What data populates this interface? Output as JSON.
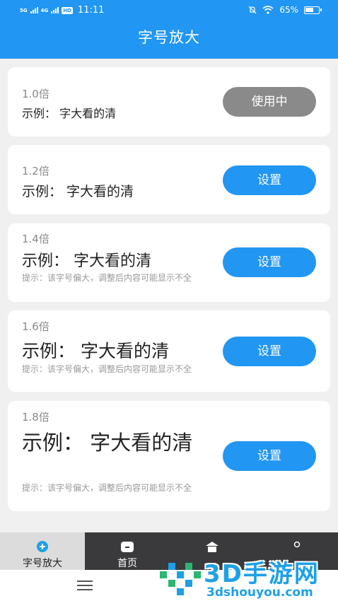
{
  "status_bar": {
    "network_1": "5G",
    "network_2": "4G",
    "hd_badge": "HD",
    "time": "11:11",
    "battery_percent": "65%",
    "battery_level": 0.65,
    "icons": [
      "mute-icon",
      "wifi-icon",
      "battery-icon"
    ]
  },
  "header": {
    "title": "字号放大"
  },
  "options": [
    {
      "level": "1.0倍",
      "example": "示例：  字大看的清",
      "hint": "",
      "button": "使用中",
      "state": "active"
    },
    {
      "level": "1.2倍",
      "example": "示例：  字大看的清",
      "hint": "",
      "button": "设置",
      "state": "set"
    },
    {
      "level": "1.4倍",
      "example": "示例：  字大看的清",
      "hint": "提示：该字号偏大，调整后内容可能显示不全",
      "button": "设置",
      "state": "set"
    },
    {
      "level": "1.6倍",
      "example": "示例：  字大看的清",
      "hint": "提示：该字号偏大，调整后内容可能显示不全",
      "button": "设置",
      "state": "set"
    },
    {
      "level": "1.8倍",
      "example": "示例：  字大看的清",
      "hint": "提示：该字号偏大，调整后内容可能显示不全",
      "button": "设置",
      "state": "set"
    }
  ],
  "tabs": [
    {
      "label": "字号放大",
      "icon": "font-size-icon",
      "selected": true
    },
    {
      "label": "首页",
      "icon": "home-icon",
      "selected": false
    },
    {
      "label": "",
      "icon": "tab-icon",
      "selected": false
    },
    {
      "label": "",
      "icon": "profile-icon",
      "selected": false
    }
  ],
  "watermark": {
    "title": "3D手游网",
    "url": "3dshouyou.com"
  },
  "colors": {
    "primary": "#2196f3",
    "active_button": "#8a8a8a",
    "tabbar": "#3a3a3c",
    "watermark": "#1ea0e6"
  }
}
